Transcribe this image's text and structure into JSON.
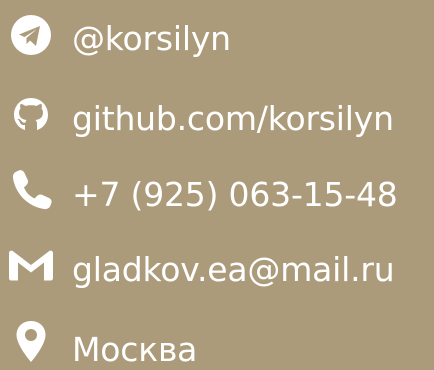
{
  "contacts": {
    "telegram": {
      "icon": "telegram-icon",
      "label": "@korsilyn"
    },
    "github": {
      "icon": "github-icon",
      "label": "github.com/korsilyn"
    },
    "phone": {
      "icon": "phone-icon",
      "label": "+7 (925) 063-15-48"
    },
    "email": {
      "icon": "gmail-icon",
      "label": "gladkov.ea@mail.ru"
    },
    "location": {
      "icon": "location-pin-icon",
      "label": "Москва"
    }
  },
  "colors": {
    "background": "#ac9b7a",
    "foreground": "#ffffff"
  }
}
